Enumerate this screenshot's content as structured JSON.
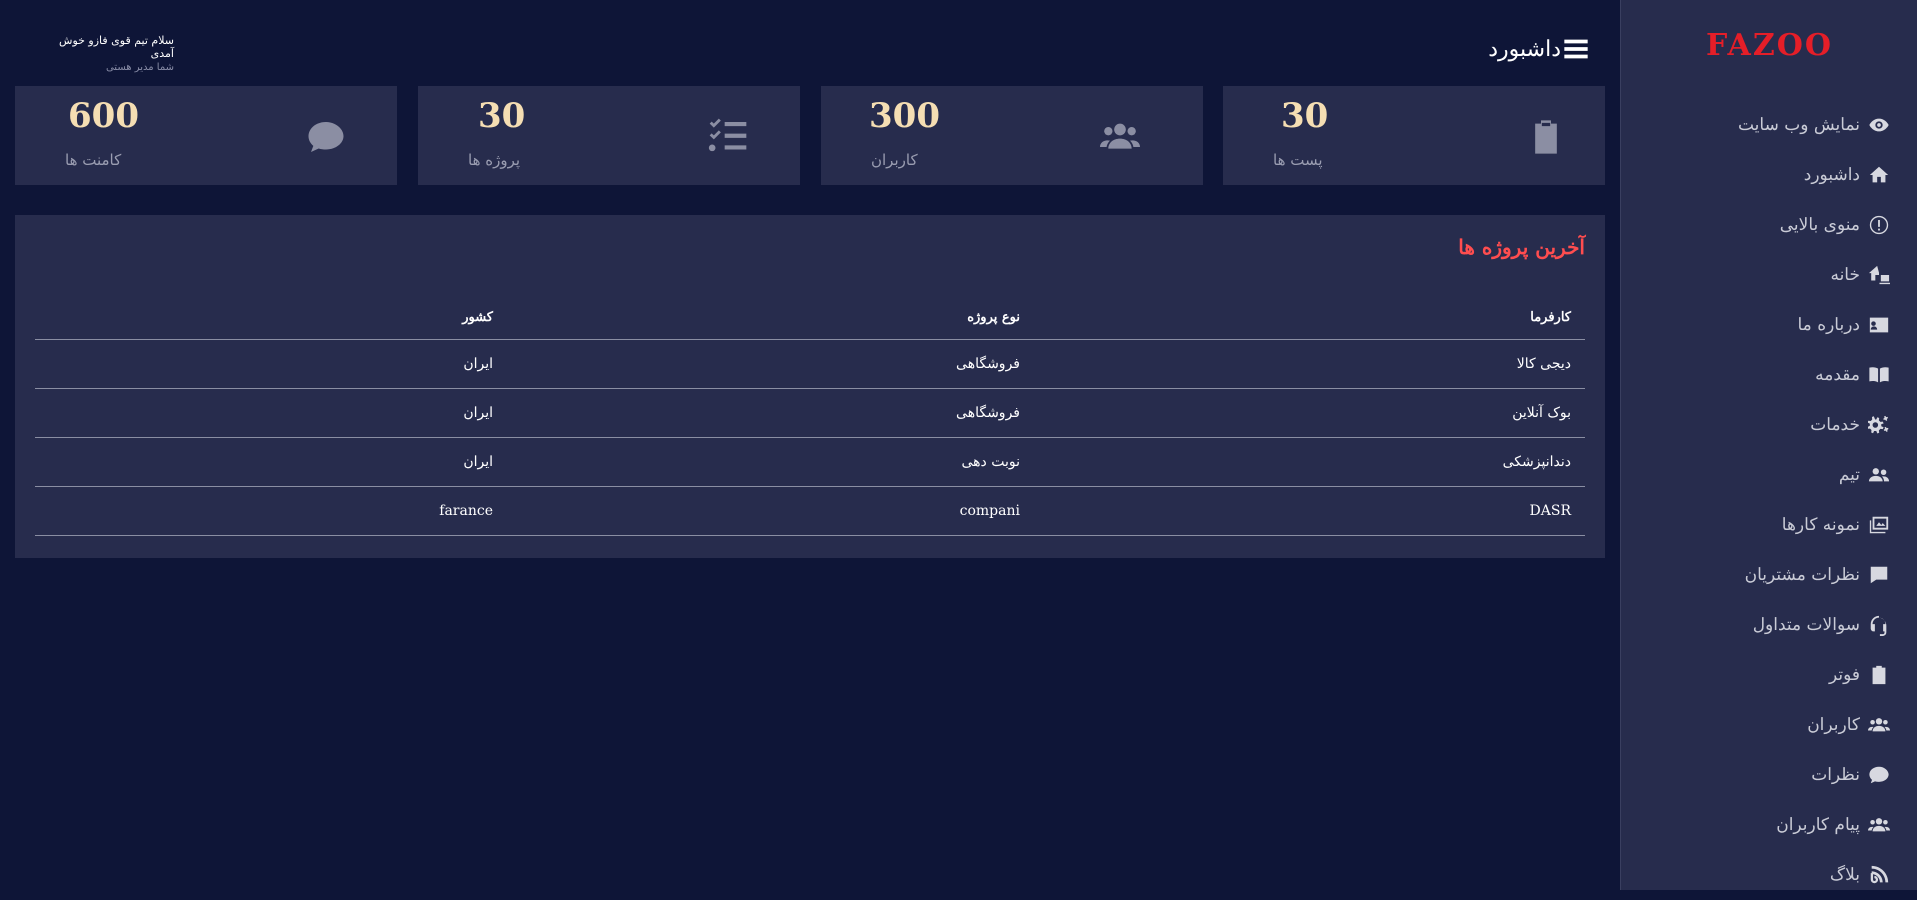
{
  "sidebar": {
    "logo": "FAZOO",
    "items": [
      {
        "label": "نمایش وب سایت",
        "icon": "eye-icon"
      },
      {
        "label": "داشبورد",
        "icon": "home-icon"
      },
      {
        "label": "منوی بالایی",
        "icon": "info-circle-icon"
      },
      {
        "label": "خانه",
        "icon": "house-laptop-icon"
      },
      {
        "label": "درباره ما",
        "icon": "id-card-icon"
      },
      {
        "label": "مقدمه",
        "icon": "book-icon"
      },
      {
        "label": "خدمات",
        "icon": "gears-icon"
      },
      {
        "label": "تیم",
        "icon": "user-group-icon"
      },
      {
        "label": "نمونه کارها",
        "icon": "images-icon"
      },
      {
        "label": "نظرات مشتریان",
        "icon": "comment-square-icon"
      },
      {
        "label": "سوالات متداول",
        "icon": "headset-icon"
      },
      {
        "label": "فوتر",
        "icon": "clipboard-list-icon"
      },
      {
        "label": "کاربران",
        "icon": "users-icon"
      },
      {
        "label": "نظرات",
        "icon": "comment-icon"
      },
      {
        "label": "پیام کاربران",
        "icon": "users-message-icon"
      },
      {
        "label": "بلاگ",
        "icon": "blog-icon"
      }
    ]
  },
  "header": {
    "title": "داشبورد",
    "greeting": "سلام تیم قوی فازو خوش آمدی",
    "role": "شما مدیر هستی"
  },
  "stats": [
    {
      "value": "30",
      "label": "پست ها",
      "icon": "clipboard-icon"
    },
    {
      "value": "300",
      "label": "کاربران",
      "icon": "users-icon"
    },
    {
      "value": "30",
      "label": "پروژه ها",
      "icon": "list-check-icon"
    },
    {
      "value": "600",
      "label": "کامنت ها",
      "icon": "comment-icon"
    }
  ],
  "projects": {
    "title": "آخرین پروژه ها",
    "columns": [
      "کارفرما",
      "نوع پروژه",
      "کشور"
    ],
    "rows": [
      [
        "دیجی کالا",
        "فروشگاهی",
        "ایران"
      ],
      [
        "بوک آنلاین",
        "فروشگاهی",
        "ایران"
      ],
      [
        "دندانپزشکی",
        "نوبت دهی",
        "ایران"
      ],
      [
        "DASR",
        "compani",
        "farance"
      ]
    ]
  },
  "colors": {
    "background": "#0e1537",
    "panel": "#272c4d",
    "logo": "#e51e28",
    "panel_title": "#ff4d4f",
    "stat_number": "#f5deb3"
  }
}
